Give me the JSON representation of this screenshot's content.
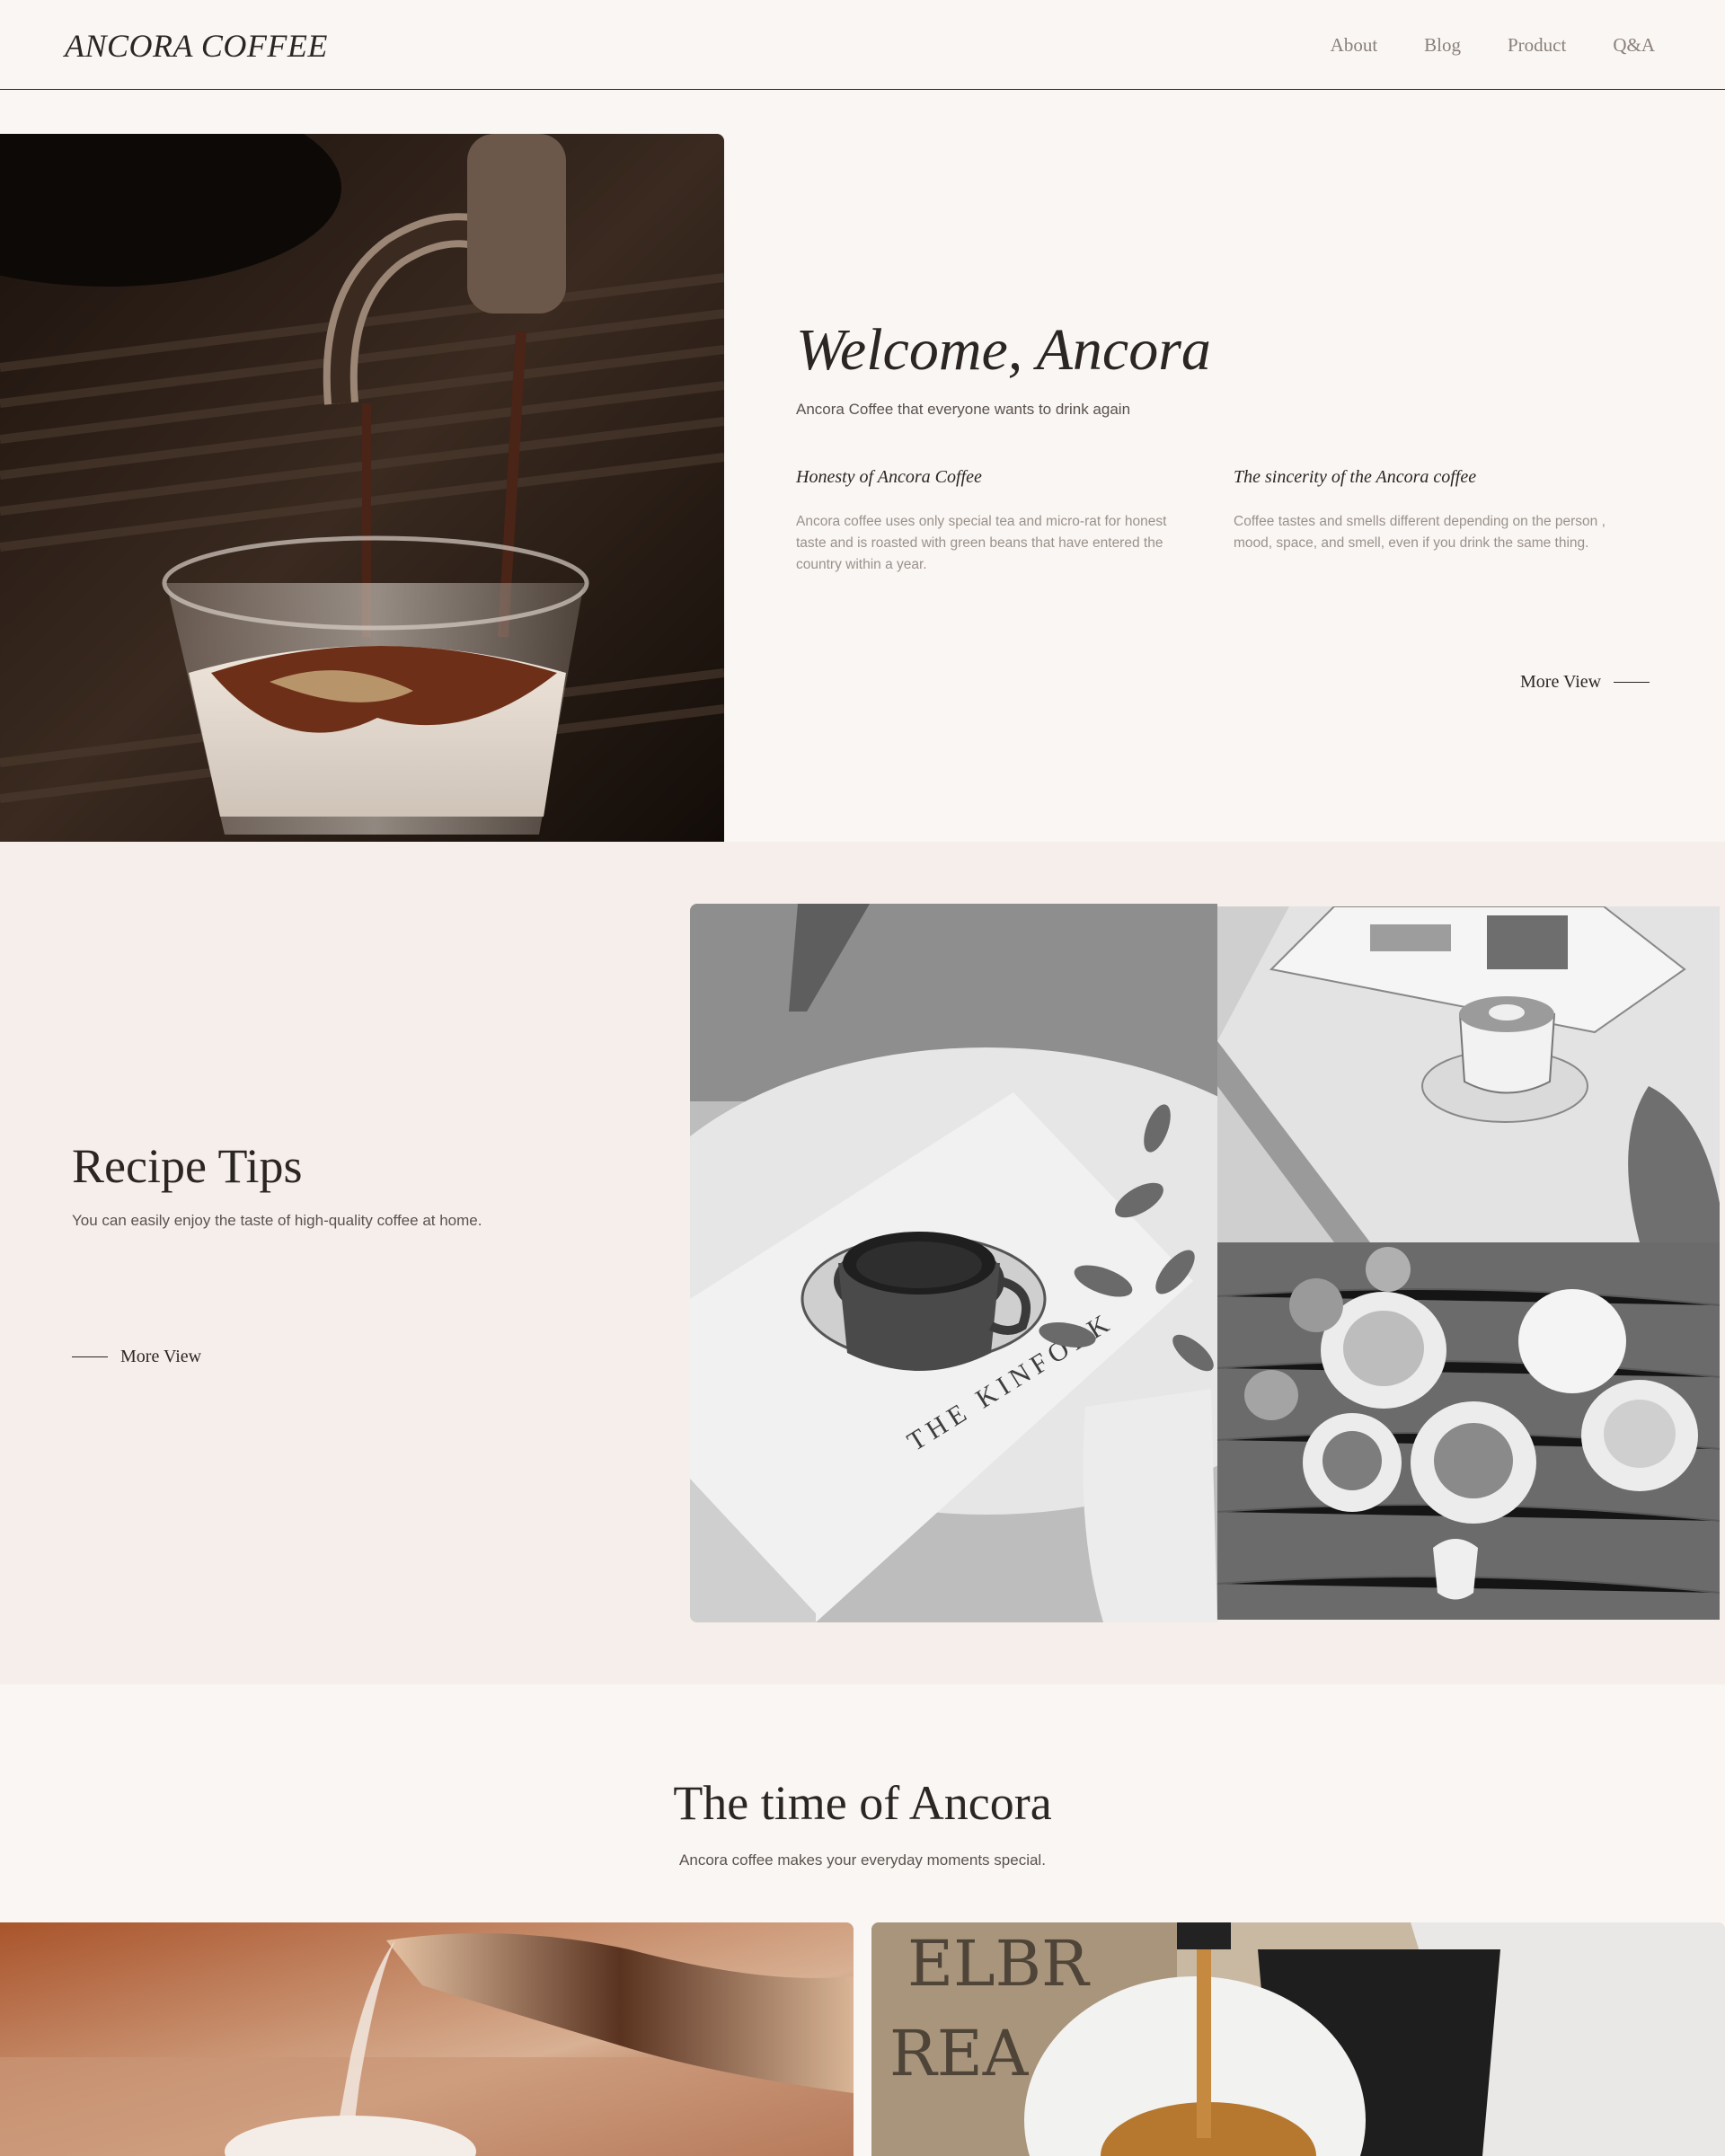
{
  "header": {
    "logo": "ANCORA COFFEE",
    "nav": [
      "About",
      "Blog",
      "Product",
      "Q&A"
    ]
  },
  "hero": {
    "title": "Welcome, Ancora",
    "subtitle": "Ancora Coffee that everyone wants to drink again",
    "features": [
      {
        "title": "Honesty of Ancora Coffee",
        "text": "Ancora coffee uses only special tea and micro-rat for honest taste and is roasted with green beans that have entered the country within a year."
      },
      {
        "title": "The sincerity of the Ancora coffee",
        "text": "Coffee tastes and smells different depending on the person , mood, space, and smell, even if you drink the same thing."
      }
    ],
    "more": "More View"
  },
  "recipe": {
    "title": "Recipe Tips",
    "subtitle": "You can easily enjoy the taste of high-quality coffee at home.",
    "more": "More View",
    "book_text": "THE KINFOLK"
  },
  "time": {
    "title": "The time of Ancora",
    "subtitle": "Ancora coffee makes your everyday moments special."
  },
  "colors": {
    "background": "#faf6f3",
    "section_bg": "#f6eeea",
    "text_dark": "#2b2623",
    "text_muted": "#9a918b"
  }
}
